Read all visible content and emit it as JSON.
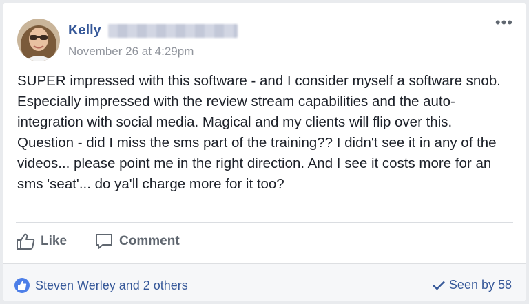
{
  "post": {
    "author_name": "Kelly",
    "timestamp": "November 26 at 4:29pm",
    "more_label": "•••",
    "body_lines": [
      "SUPER impressed with this software - and I consider myself a software snob. Especially impressed with the review stream capabilities and the auto-integration with social media. Magical and my clients will flip over this.",
      "Question - did I miss the sms part of the training?? I didn't see it in any of the videos... please point me in the right direction. And I see it costs more for an sms 'seat'... do ya'll charge more for it too?"
    ]
  },
  "actions": {
    "like_label": "Like",
    "comment_label": "Comment"
  },
  "footer": {
    "reactions_text": "Steven Werley and 2 others",
    "seen_text": "Seen by 58"
  },
  "colors": {
    "link_blue": "#365899",
    "text": "#1d2129",
    "muted": "#606770",
    "like_badge": "#4d7fe8"
  },
  "icons": [
    "avatar",
    "more-icon",
    "like-icon",
    "comment-icon",
    "like-reaction-icon",
    "check-icon"
  ]
}
